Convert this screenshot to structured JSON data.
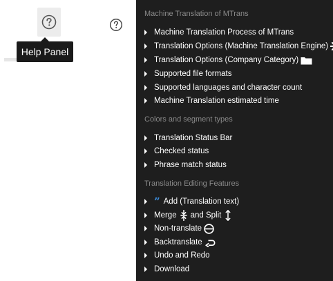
{
  "tooltip": {
    "text": "Help Panel"
  },
  "menu": {
    "sections": [
      {
        "title": "Machine Translation of MTrans",
        "items": [
          "Machine Translation Process of MTrans",
          "Translation Options (Machine Translation Engine)",
          "Translation Options (Company Category)",
          "Supported file formats",
          "Supported languages and character count",
          "Machine Translation estimated time"
        ]
      },
      {
        "title": "Colors and segment types",
        "items": [
          "Translation Status Bar",
          "Checked status",
          "Phrase match status"
        ]
      },
      {
        "title": "Translation Editing Features",
        "items": [
          "Add (Translation text)",
          "Merge",
          "and Split",
          "Non-translate",
          "Backtranslate",
          "Undo and Redo",
          "Download"
        ]
      }
    ]
  },
  "icons": {
    "help": "question-circle-icon",
    "engine": "gear-icon",
    "category": "folder-icon",
    "add": "quote-icon",
    "merge": "merge-arrows-icon",
    "split": "split-arrows-icon",
    "non_translate": "minus-circle-icon",
    "backtranslate": "return-arrow-icon"
  },
  "colors": {
    "panel_bg": "#1e1e1e",
    "section_title": "#8a8a8a",
    "quote_accent": "#3b8fe0",
    "tooltip_bg": "#1a1a1a"
  }
}
